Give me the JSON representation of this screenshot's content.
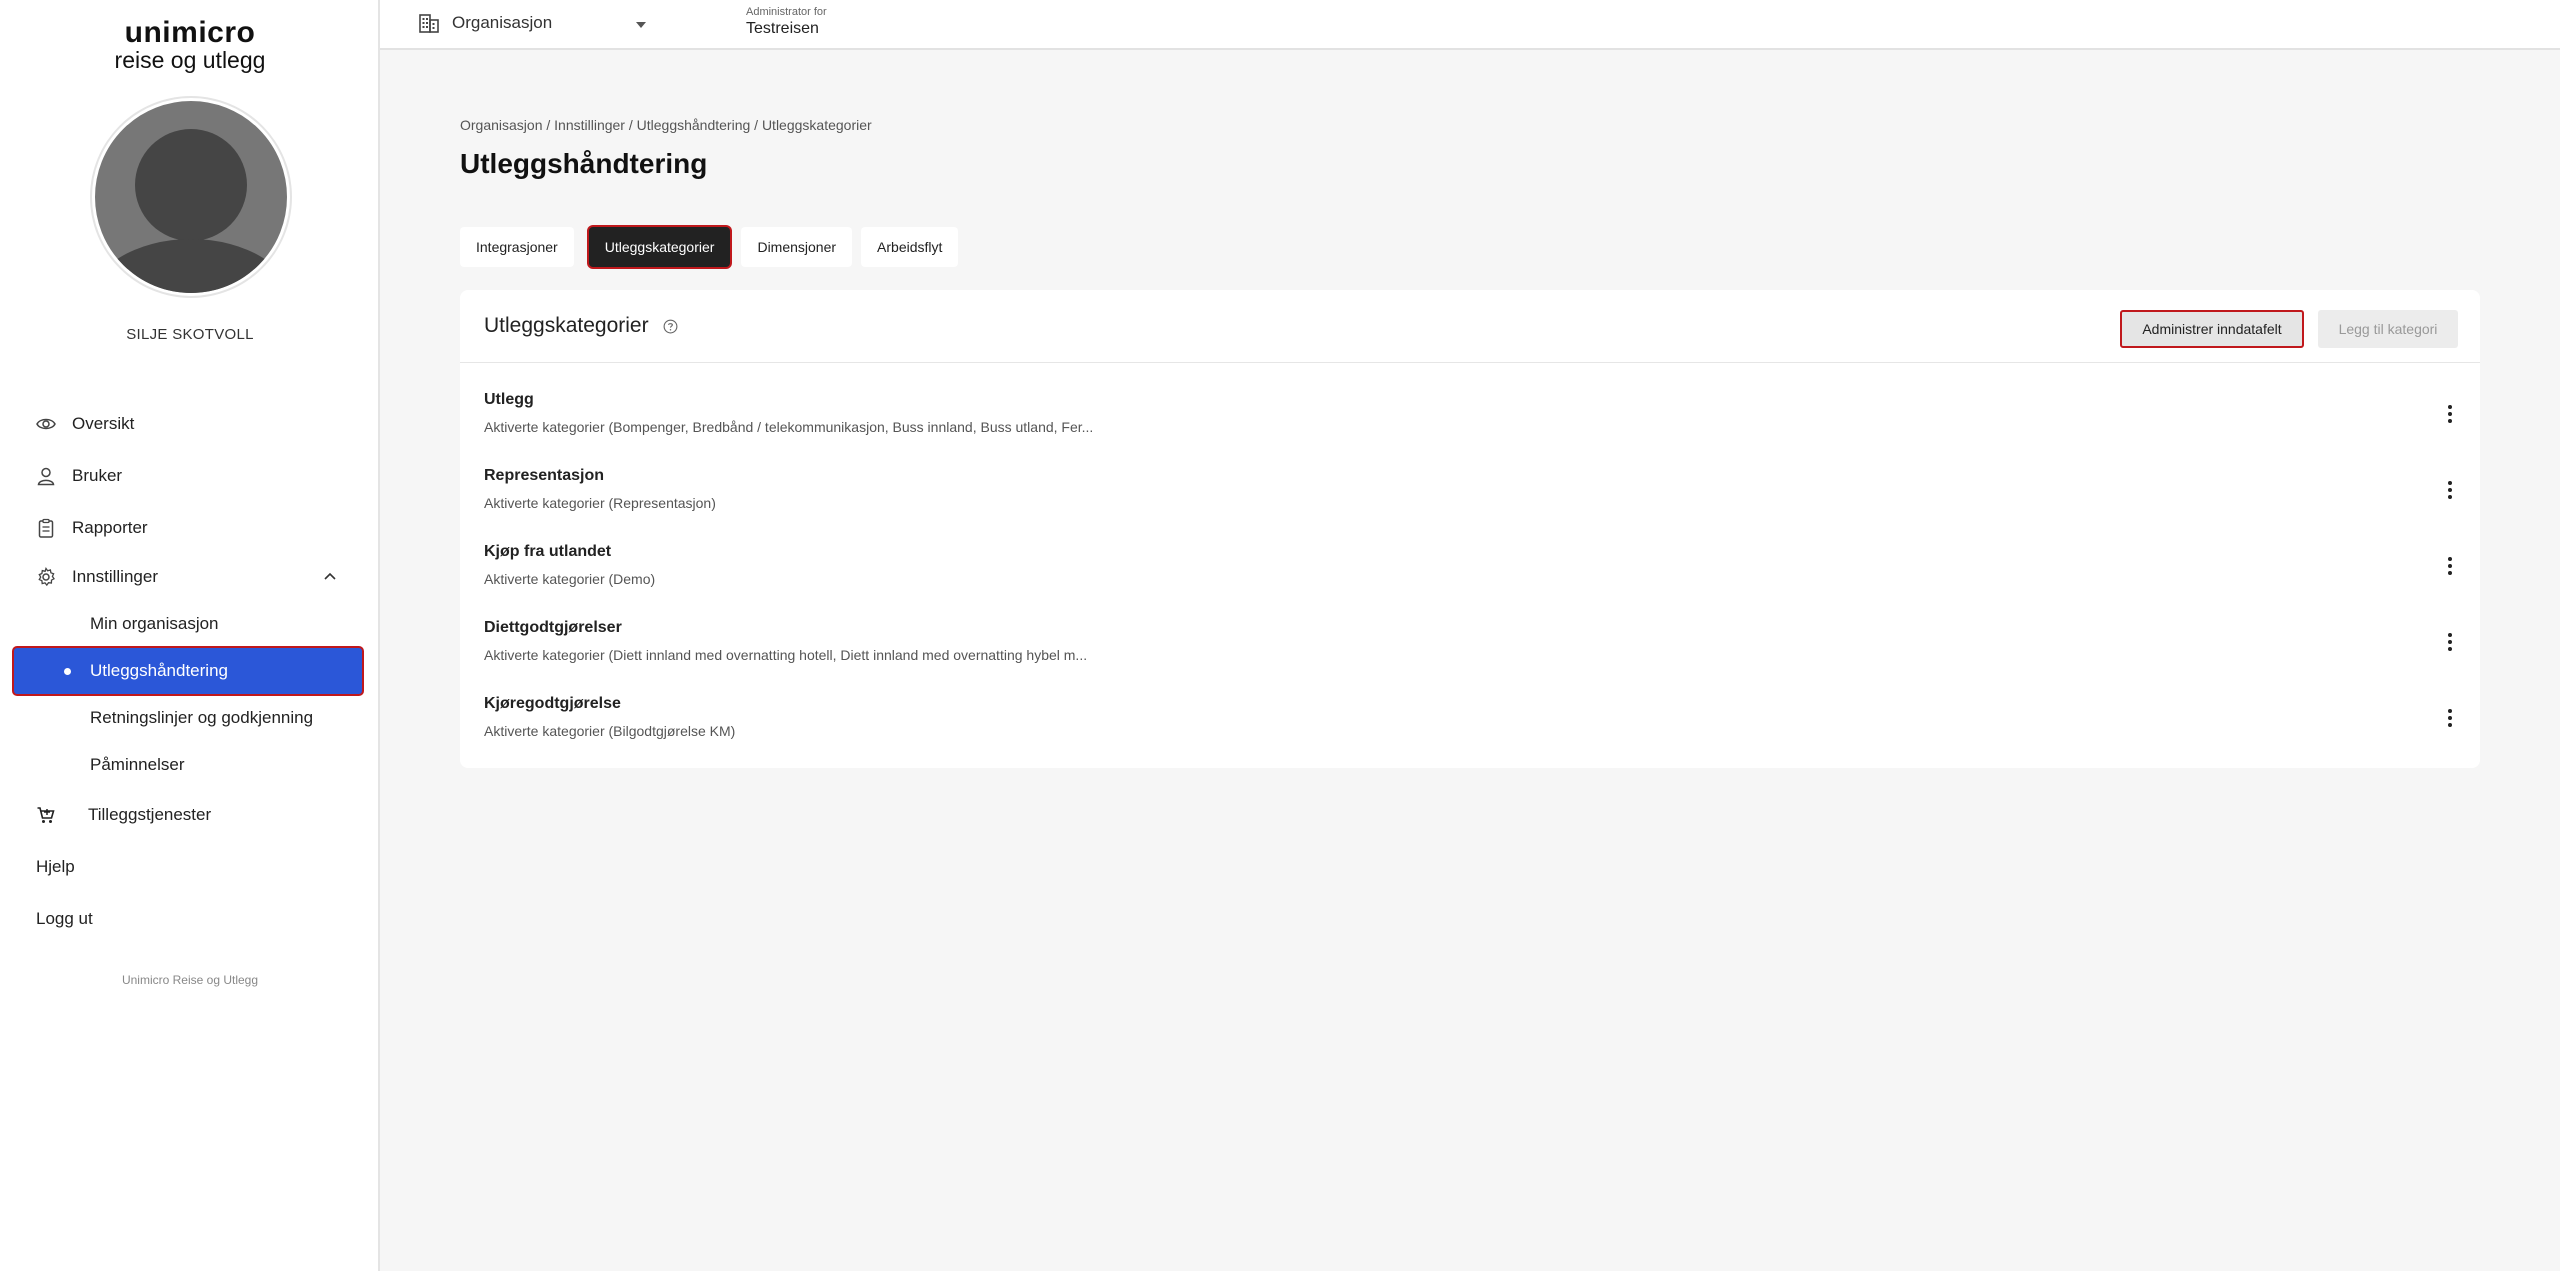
{
  "sidebar": {
    "logo_line1": "unimicro",
    "logo_line2": "reise og utlegg",
    "user_name": "SILJE SKOTVOLL",
    "items": [
      {
        "label": "Oversikt",
        "icon": "eye-icon"
      },
      {
        "label": "Bruker",
        "icon": "user-icon"
      },
      {
        "label": "Rapporter",
        "icon": "clipboard-icon"
      },
      {
        "label": "Innstillinger",
        "icon": "gear-icon"
      }
    ],
    "sub_items": [
      {
        "label": "Min organisasjon"
      },
      {
        "label": "Utleggshåndtering"
      },
      {
        "label": "Retningslinjer og godkjenning"
      },
      {
        "label": "Påminnelser"
      }
    ],
    "extra_items": [
      {
        "label": "Tilleggstjenester",
        "icon": "cart-icon"
      },
      {
        "label": "Hjelp"
      },
      {
        "label": "Logg ut"
      }
    ],
    "footer": "Unimicro Reise og Utlegg"
  },
  "topbar": {
    "org_label": "Organisasjon",
    "admin_for_label": "Administrator for",
    "admin_for_value": "Testreisen"
  },
  "main": {
    "breadcrumb": "Organisasjon / Innstillinger / Utleggshåndtering / Utleggskategorier",
    "title": "Utleggshåndtering",
    "tabs": [
      {
        "label": "Integrasjoner"
      },
      {
        "label": "Utleggskategorier",
        "active": true
      },
      {
        "label": "Dimensjoner"
      },
      {
        "label": "Arbeidsflyt"
      }
    ],
    "card": {
      "title": "Utleggskategorier",
      "admin_button": "Administrer inndatafelt",
      "add_button": "Legg til kategori",
      "rows": [
        {
          "name": "Utlegg",
          "desc": "Aktiverte kategorier (Bompenger, Bredbånd / telekommunikasjon, Buss innland, Buss utland, Fer..."
        },
        {
          "name": "Representasjon",
          "desc": "Aktiverte kategorier (Representasjon)"
        },
        {
          "name": "Kjøp fra utlandet",
          "desc": "Aktiverte kategorier (Demo)"
        },
        {
          "name": "Diettgodtgjørelser",
          "desc": "Aktiverte kategorier (Diett innland med overnatting hotell, Diett innland med overnatting hybel m..."
        },
        {
          "name": "Kjøregodtgjørelse",
          "desc": "Aktiverte kategorier (Bilgodtgjørelse KM)"
        }
      ]
    }
  },
  "colors": {
    "accent": "#2b57d8",
    "highlight_border": "#c0181c",
    "active_tab_bg": "#222222"
  }
}
